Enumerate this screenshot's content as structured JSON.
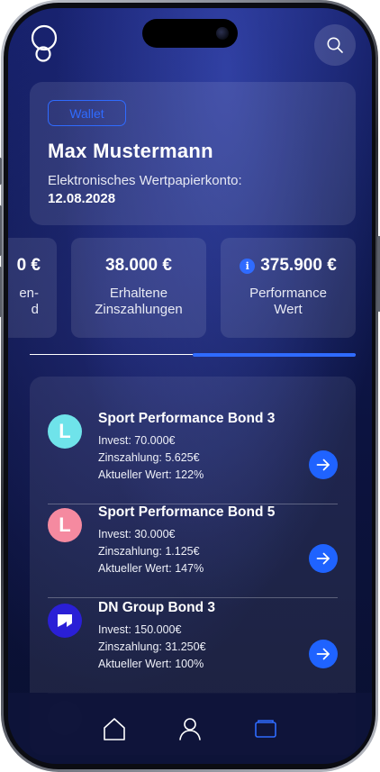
{
  "header": {
    "badge": "Wallet",
    "owner_name": "Max Mustermann",
    "account_label": "Elektronisches Wertpapierkonto:",
    "account_date": "12.08.2028"
  },
  "stats": [
    {
      "value": "0 €",
      "label_line1": "en-",
      "label_line2": "d"
    },
    {
      "value": "38.000 €",
      "label_line1": "Erhaltene",
      "label_line2": "Zinszahlungen"
    },
    {
      "value": "375.900 €",
      "label_line1": "Performance",
      "label_line2": "Wert",
      "info_icon": "info-icon"
    }
  ],
  "carousel": {
    "active_index": 1,
    "page_count": 2
  },
  "bonds": [
    {
      "name": "Sport Performance Bond 3",
      "invest": "Invest: 70.000€",
      "interest": "Zinszahlung: 5.625€",
      "current_value": "Aktueller Wert: 122%",
      "avatar_letter": "L",
      "avatar_color": "#6fe3ea"
    },
    {
      "name": "Sport Performance Bond 5",
      "invest": "Invest: 30.000€",
      "interest": "Zinszahlung: 1.125€",
      "current_value": "Aktueller Wert: 147%",
      "avatar_letter": "L",
      "avatar_color": "#f58aa0"
    },
    {
      "name": "DN Group Bond 3",
      "invest": "Invest: 150.000€",
      "interest": "Zinszahlung: 31.250€",
      "current_value": "Aktueller Wert: 100%",
      "avatar_letter": "",
      "avatar_color": "#2a1fd6"
    }
  ],
  "tabs": [
    {
      "icon": "home-icon",
      "active": false
    },
    {
      "icon": "profile-icon",
      "active": false
    },
    {
      "icon": "wallet-icon",
      "active": true
    }
  ],
  "colors": {
    "accent": "#2f6bff",
    "background_top": "#16206b",
    "background_bottom": "#0a1030"
  }
}
